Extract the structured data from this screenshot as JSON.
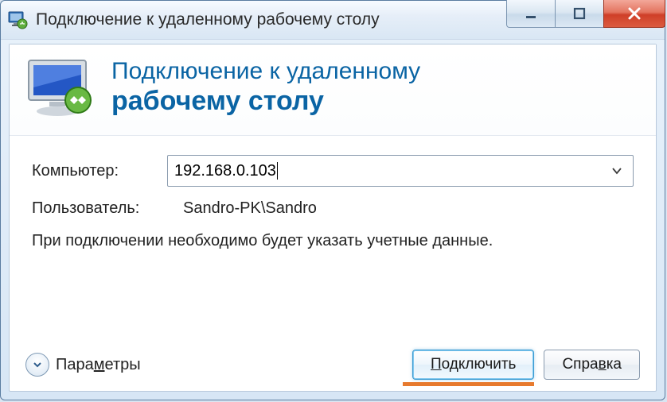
{
  "titlebar": {
    "title": "Подключение к удаленному рабочему столу"
  },
  "banner": {
    "line1": "Подключение к удаленному",
    "line2": "рабочему столу"
  },
  "form": {
    "computer_label": "Компьютер:",
    "computer_value": "192.168.0.103",
    "user_label": "Пользователь:",
    "user_value": "Sandro-PK\\Sandro",
    "note": "При подключении необходимо будет указать учетные данные."
  },
  "footer": {
    "options_label_prefix": "Пара",
    "options_label_u": "м",
    "options_label_suffix": "етры",
    "connect_label_prefix": "",
    "connect_label_u": "П",
    "connect_label_suffix": "одключить",
    "help_label_prefix": "Спра",
    "help_label_u": "в",
    "help_label_suffix": "ка"
  }
}
